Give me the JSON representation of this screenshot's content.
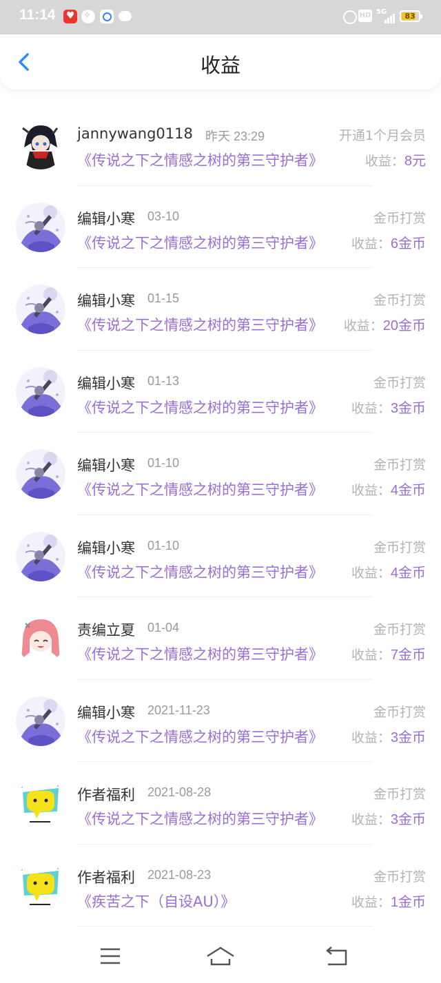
{
  "status": {
    "time": "11:14",
    "hd": "HD",
    "network": "5G",
    "battery": "83",
    "battery_level": 0.83
  },
  "header": {
    "title": "收益"
  },
  "list": [
    {
      "avatar": "anime-boy-avatar",
      "name": "jannywang0118",
      "date": "昨天  23:29",
      "type": "开通1个月会员",
      "book": "《传说之下之情感之树的第三守护者》",
      "income_label": "收益：",
      "income_value": "8元"
    },
    {
      "avatar": "purple-girl-avatar",
      "name": "编辑小寒",
      "date": "03-10",
      "type": "金币打赏",
      "book": "《传说之下之情感之树的第三守护者》",
      "income_label": "收益：",
      "income_value": "6金币"
    },
    {
      "avatar": "purple-girl-avatar",
      "name": "编辑小寒",
      "date": "01-15",
      "type": "金币打赏",
      "book": "《传说之下之情感之树的第三守护者》",
      "income_label": "收益：",
      "income_value": "20金币"
    },
    {
      "avatar": "purple-girl-avatar",
      "name": "编辑小寒",
      "date": "01-13",
      "type": "金币打赏",
      "book": "《传说之下之情感之树的第三守护者》",
      "income_label": "收益：",
      "income_value": "3金币"
    },
    {
      "avatar": "purple-girl-avatar",
      "name": "编辑小寒",
      "date": "01-10",
      "type": "金币打赏",
      "book": "《传说之下之情感之树的第三守护者》",
      "income_label": "收益：",
      "income_value": "4金币"
    },
    {
      "avatar": "purple-girl-avatar",
      "name": "编辑小寒",
      "date": "01-10",
      "type": "金币打赏",
      "book": "《传说之下之情感之树的第三守护者》",
      "income_label": "收益：",
      "income_value": "4金币"
    },
    {
      "avatar": "pink-hair-girl-avatar",
      "name": "责编立夏",
      "date": "01-04",
      "type": "金币打赏",
      "book": "《传说之下之情感之树的第三守护者》",
      "income_label": "收益：",
      "income_value": "7金币"
    },
    {
      "avatar": "purple-girl-avatar",
      "name": "编辑小寒",
      "date": "2021-11-23",
      "type": "金币打赏",
      "book": "《传说之下之情感之树的第三守护者》",
      "income_label": "收益：",
      "income_value": "3金币"
    },
    {
      "avatar": "yellow-chat-bubble-avatar",
      "name": "作者福利",
      "date": "2021-08-28",
      "type": "金币打赏",
      "book": "《传说之下之情感之树的第三守护者》",
      "income_label": "收益：",
      "income_value": "3金币"
    },
    {
      "avatar": "yellow-chat-bubble-avatar",
      "name": "作者福利",
      "date": "2021-08-23",
      "type": "金币打赏",
      "book": "《疾苦之下（自设AU）》",
      "income_label": "收益：",
      "income_value": "1金币"
    }
  ],
  "colors": {
    "accent_purple": "#9b6ed3",
    "back_blue": "#2a8ff0",
    "muted_gray": "#b3b3b3"
  }
}
